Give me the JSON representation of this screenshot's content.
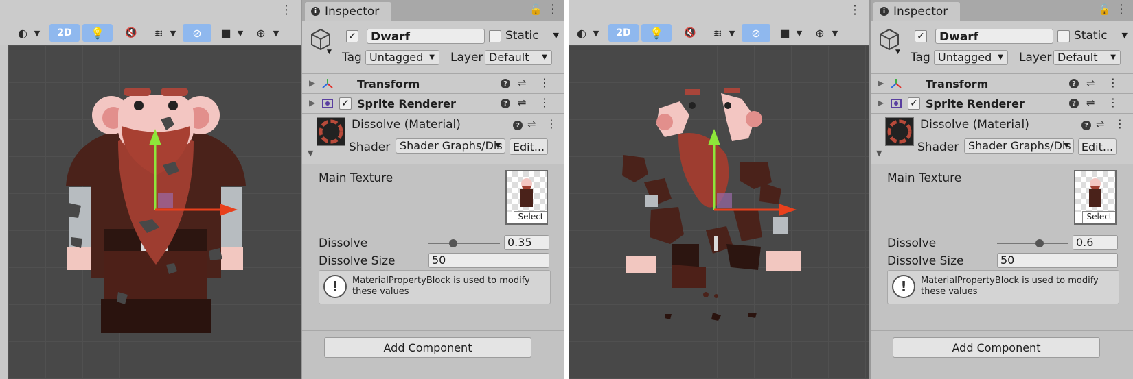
{
  "left": {
    "scene": {
      "toolbar": {
        "mode_2d": "2D"
      }
    },
    "inspector": {
      "tab_title": "Inspector",
      "object": {
        "name": "Dwarf",
        "active": true,
        "static_label": "Static",
        "static": false
      },
      "tag": {
        "label": "Tag",
        "value": "Untagged"
      },
      "layer": {
        "label": "Layer",
        "value": "Default"
      },
      "components": {
        "transform": "Transform",
        "sprite_renderer": "Sprite Renderer"
      },
      "material": {
        "name": "Dissolve (Material)",
        "shader_label": "Shader",
        "shader_value": "Shader Graphs/Dis",
        "edit_label": "Edit..."
      },
      "properties": {
        "main_texture_label": "Main Texture",
        "select_label": "Select",
        "dissolve_label": "Dissolve",
        "dissolve_value": "0.35",
        "dissolve_fraction": 0.35,
        "dissolve_size_label": "Dissolve Size",
        "dissolve_size_value": "50"
      },
      "help_message": "MaterialPropertyBlock is used to modify these values",
      "add_component_label": "Add Component"
    }
  },
  "right": {
    "scene": {
      "toolbar": {
        "mode_2d": "2D"
      }
    },
    "inspector": {
      "tab_title": "Inspector",
      "object": {
        "name": "Dwarf",
        "active": true,
        "static_label": "Static",
        "static": false
      },
      "tag": {
        "label": "Tag",
        "value": "Untagged"
      },
      "layer": {
        "label": "Layer",
        "value": "Default"
      },
      "components": {
        "transform": "Transform",
        "sprite_renderer": "Sprite Renderer"
      },
      "material": {
        "name": "Dissolve (Material)",
        "shader_label": "Shader",
        "shader_value": "Shader Graphs/Dis",
        "edit_label": "Edit..."
      },
      "properties": {
        "main_texture_label": "Main Texture",
        "select_label": "Select",
        "dissolve_label": "Dissolve",
        "dissolve_value": "0.6",
        "dissolve_fraction": 0.6,
        "dissolve_size_label": "Dissolve Size",
        "dissolve_size_value": "50"
      },
      "help_message": "MaterialPropertyBlock is used to modify these values",
      "add_component_label": "Add Component"
    }
  },
  "icons": {
    "shading": "shading-mode-icon",
    "light": "lighting-toggle-icon",
    "audio": "audio-toggle-icon",
    "fx": "effects-icon",
    "visibility": "scene-visibility-icon",
    "camera": "camera-icon",
    "gizmos": "gizmos-icon"
  },
  "colors": {
    "toggle_on": "#8fb8ee",
    "gizmo_x": "#e8401c",
    "gizmo_y": "#8ee63a"
  }
}
